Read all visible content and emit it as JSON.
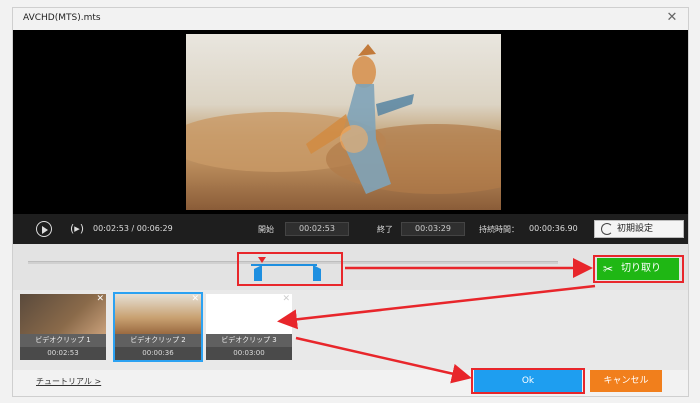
{
  "window": {
    "title": "AVCHD(MTS).mts"
  },
  "controls": {
    "current_time": "00:02:53",
    "separator": "/",
    "total_time": "00:06:29",
    "start_label": "開始",
    "start_value": "00:02:53",
    "end_label": "終了",
    "end_value": "00:03:29",
    "duration_label": "持続時間：",
    "duration_value": "00:00:36.90",
    "reset_label": "初期設定"
  },
  "cut_button": {
    "label": "切り取り"
  },
  "clips": [
    {
      "name": "ビデオクリップ 1",
      "duration": "00:02:53"
    },
    {
      "name": "ビデオクリップ 2",
      "duration": "00:00:36"
    },
    {
      "name": "ビデオクリップ 3",
      "duration": "00:03:00"
    }
  ],
  "footer": {
    "tutorial": "チュートリアル >",
    "ok": "Ok",
    "cancel": "キャンセル"
  },
  "colors": {
    "annotation_red": "#e8262b",
    "cut_green": "#1fb714",
    "ok_blue": "#1e9ef0",
    "cancel_orange": "#f17f1c",
    "selection_blue": "#1e8fe0"
  }
}
